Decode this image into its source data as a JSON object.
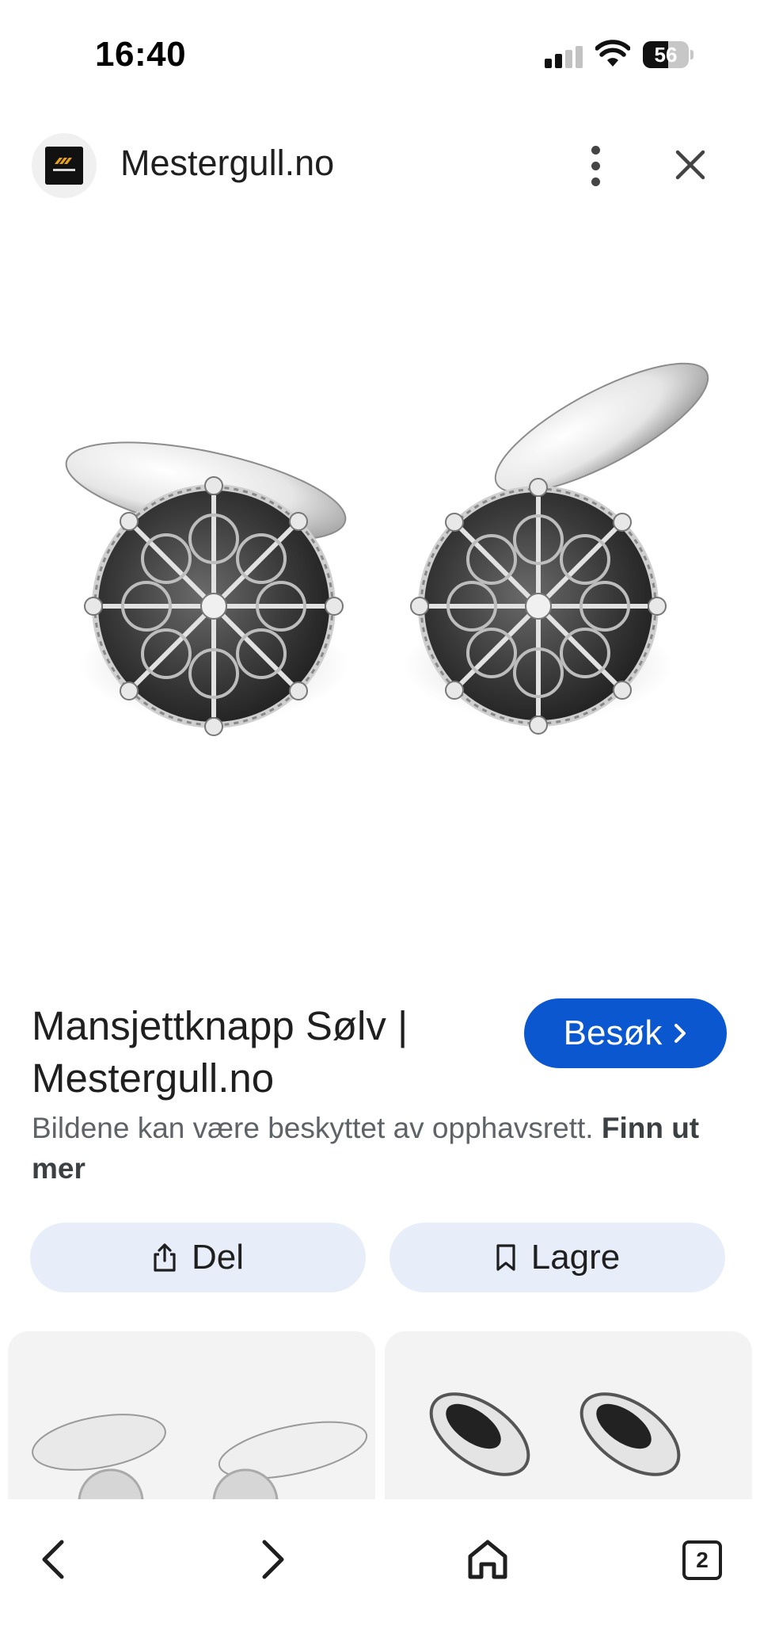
{
  "status_bar": {
    "time": "16:40",
    "battery_level": "56",
    "icons": [
      "signal-icon",
      "wifi-icon",
      "battery-icon"
    ]
  },
  "header": {
    "favicon": "mestergull-logo",
    "site_name": "Mestergull.no",
    "more_icon": "more-vertical-icon",
    "close_icon": "close-icon"
  },
  "image": {
    "subject": "silver filigree cufflinks"
  },
  "result": {
    "title": "Mansjettknapp Sølv | Mestergull.no",
    "visit_label": "Besøk",
    "copyright_text": "Bildene kan være beskyttet av opphavsrett.",
    "learn_more": "Finn ut mer"
  },
  "actions": {
    "share_label": "Del",
    "save_label": "Lagre"
  },
  "bottom_nav": {
    "tab_count": "2"
  },
  "colors": {
    "accent": "#0b57d0",
    "chip_bg": "#e8eef9",
    "text_secondary": "#5f6368"
  }
}
